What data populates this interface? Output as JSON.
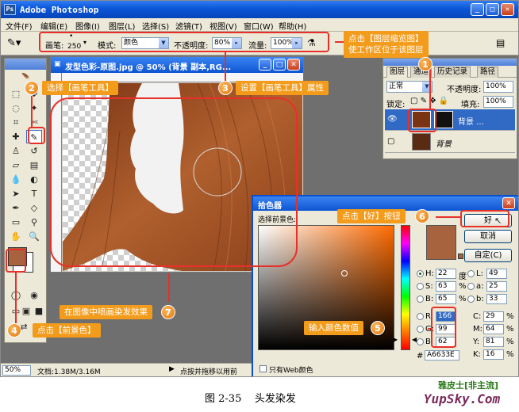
{
  "app": {
    "title": "Adobe Photoshop",
    "logo": "Ps"
  },
  "menu": [
    "文件(F)",
    "编辑(E)",
    "图像(I)",
    "图层(L)",
    "选择(S)",
    "滤镜(T)",
    "视图(V)",
    "窗口(W)",
    "帮助(H)"
  ],
  "options": {
    "brush_label": "画笔:",
    "brush_size": "250",
    "mode_label": "模式:",
    "mode_value": "颜色",
    "opacity_label": "不透明度:",
    "opacity_value": "80%",
    "flow_label": "流量:",
    "flow_value": "100%"
  },
  "document": {
    "title": "发型色彩-原图.jpg @ 50% (背景 副本,RG..."
  },
  "layers": {
    "tabs": [
      "图层",
      "通道",
      "历史记录",
      "路径"
    ],
    "blend_mode": "正常",
    "opacity_label": "不透明度:",
    "opacity_value": "100%",
    "lock_label": "锁定:",
    "fill_label": "填充:",
    "fill_value": "100%",
    "items": [
      {
        "name": "背景 ..."
      },
      {
        "name": "背景"
      }
    ]
  },
  "color_picker": {
    "title": "拾色器",
    "label": "选择前景色:",
    "ok": "好",
    "cancel": "取消",
    "custom": "自定(C)",
    "web_only": "只有Web颜色",
    "hex": "A6633E",
    "hsb": [
      {
        "label": "H:",
        "value": "22",
        "unit": "度"
      },
      {
        "label": "S:",
        "value": "63",
        "unit": "%"
      },
      {
        "label": "B:",
        "value": "65",
        "unit": "%"
      }
    ],
    "rgb": [
      {
        "label": "R:",
        "value": "166"
      },
      {
        "label": "G:",
        "value": "99"
      },
      {
        "label": "B:",
        "value": "62"
      }
    ],
    "lab": [
      {
        "label": "L:",
        "value": "49"
      },
      {
        "label": "a:",
        "value": "25"
      },
      {
        "label": "b:",
        "value": "33"
      }
    ],
    "cmyk": [
      {
        "label": "C:",
        "value": "29",
        "unit": "%"
      },
      {
        "label": "M:",
        "value": "64",
        "unit": "%"
      },
      {
        "label": "Y:",
        "value": "81",
        "unit": "%"
      },
      {
        "label": "K:",
        "value": "16",
        "unit": "%"
      }
    ],
    "new_color": "#a6633e",
    "old_color": "#a6633e"
  },
  "status": {
    "zoom": "50%",
    "doc": "文档:1.38M/3.16M",
    "hint": "点按并拖移以用前"
  },
  "callouts": {
    "c1": "点击【图层缩览图】",
    "c1b": "使工作区位于该图层",
    "c2": "选择【画笔工具】",
    "c3": "设置【画笔工具】属性",
    "c4": "点击【前景色】",
    "c5": "输入颜色数值",
    "c6": "点击【好】按钮",
    "c7": "在图像中喷画染发效果"
  },
  "steps": [
    "1",
    "2",
    "3",
    "4",
    "5",
    "6",
    "7"
  ],
  "caption": "图 2-35    头发染发",
  "watermark": {
    "line1": "雅皮士[非主流]",
    "line2": "YupSky.Com"
  },
  "colors": {
    "accent": "#f39b1b",
    "highlight": "#e8302a",
    "foreground": "#a6633e",
    "titlebar": "#0d55d2"
  }
}
